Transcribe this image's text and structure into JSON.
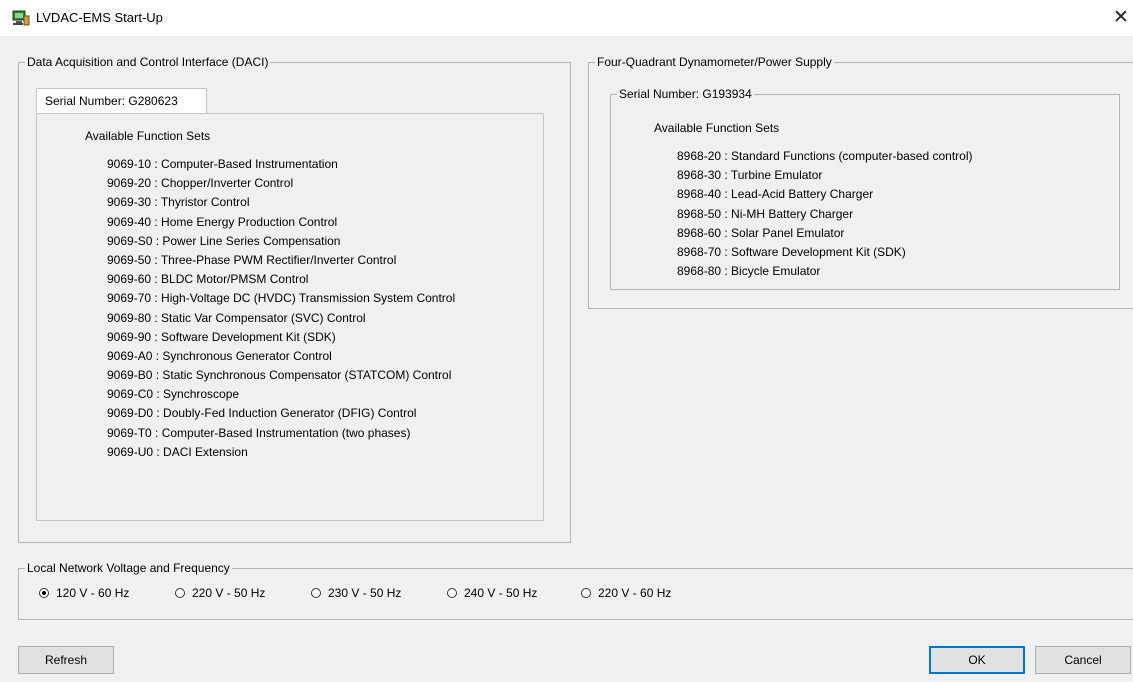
{
  "window": {
    "title": "LVDAC-EMS Start-Up",
    "icon": "computer-icon",
    "close": "✕"
  },
  "daci": {
    "legend": "Data Acquisition and Control Interface (DACI)",
    "tab_label": "Serial Number: G280623",
    "heading": "Available Function Sets",
    "items": [
      "9069-10 :  Computer-Based Instrumentation",
      "9069-20 : Chopper/Inverter Control",
      "9069-30 : Thyristor Control",
      "9069-40 :  Home Energy Production Control",
      "9069-S0 :  Power Line Series Compensation",
      "9069-50 :  Three-Phase PWM Rectifier/Inverter Control",
      "9069-60 : BLDC Motor/PMSM Control",
      "9069-70 :  High-Voltage DC (HVDC) Transmission System Control",
      "9069-80 :  Static Var Compensator (SVC) Control",
      "9069-90 : Software Development Kit (SDK)",
      "9069-A0 : Synchronous Generator Control",
      "9069-B0 :  Static Synchronous Compensator (STATCOM) Control",
      "9069-C0 : Synchroscope",
      "9069-D0 :  Doubly-Fed Induction Generator (DFIG) Control",
      "9069-T0 :  Computer-Based Instrumentation (two phases)",
      "9069-U0 : DACI Extension"
    ]
  },
  "dyn": {
    "legend": "Four-Quadrant Dynamometer/Power Supply",
    "serial_legend": "Serial Number: G193934",
    "heading": "Available Function Sets",
    "items": [
      "8968-20 :  Standard Functions (computer-based control)",
      "8968-30 : Turbine Emulator",
      "8968-40 : Lead-Acid Battery Charger",
      "8968-50 : Ni-MH Battery Charger",
      "8968-60 : Solar Panel Emulator",
      "8968-70 : Software Development Kit (SDK)",
      "8968-80 : Bicycle Emulator"
    ]
  },
  "network": {
    "legend": "Local Network Voltage and Frequency",
    "options": [
      {
        "label": "120 V - 60 Hz",
        "selected": true
      },
      {
        "label": "220 V - 50 Hz",
        "selected": false
      },
      {
        "label": "230 V - 50 Hz",
        "selected": false
      },
      {
        "label": "240 V - 50 Hz",
        "selected": false
      },
      {
        "label": "220 V - 60 Hz",
        "selected": false
      }
    ]
  },
  "buttons": {
    "refresh": "Refresh",
    "ok": "OK",
    "cancel": "Cancel"
  },
  "colors": {
    "accent_border": "#0078d7",
    "group_border": "#b4b4b4",
    "background": "#f0f0f0"
  }
}
